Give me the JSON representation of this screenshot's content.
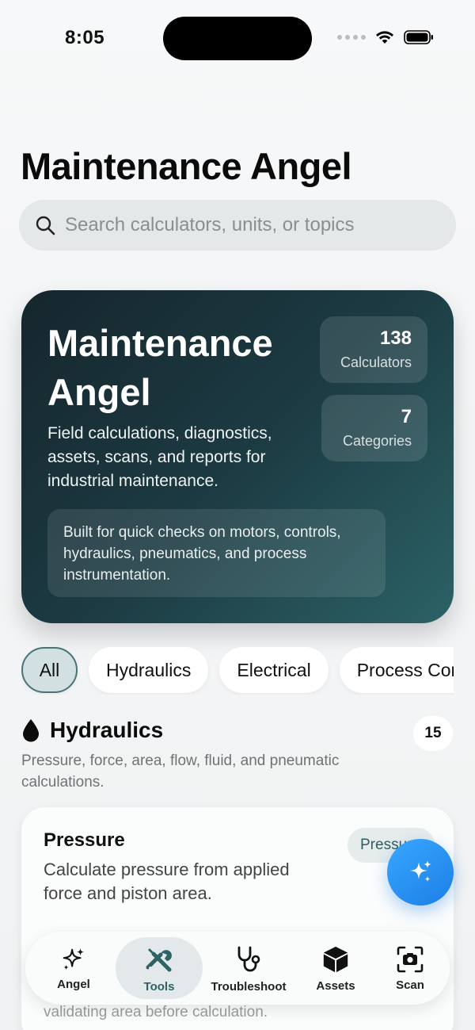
{
  "status": {
    "time": "8:05"
  },
  "app": {
    "title": "Maintenance Angel"
  },
  "search": {
    "placeholder": "Search calculators, units, or topics"
  },
  "hero": {
    "title": "Maintenance Angel",
    "subtitle": "Field calculations, diagnostics, assets, scans, and reports for industrial maintenance.",
    "stats": [
      {
        "value": "138",
        "label": "Calculators"
      },
      {
        "value": "7",
        "label": "Categories"
      }
    ],
    "note": "Built for quick checks on motors, controls, hydraulics, pneumatics, and process instrumentation."
  },
  "filters": {
    "chips": [
      {
        "label": "All",
        "active": true
      },
      {
        "label": "Hydraulics",
        "active": false
      },
      {
        "label": "Electrical",
        "active": false
      },
      {
        "label": "Process Control",
        "active": false
      }
    ]
  },
  "section": {
    "title": "Hydraulics",
    "count": "15",
    "description": "Pressure, force, area, flow, fluid, and pneumatic calculations.",
    "icon": "drop-icon"
  },
  "calculator": {
    "title": "Pressure",
    "description": "Calculate pressure from applied force and piston area.",
    "tag": "Pressure",
    "footer": "validating area before calculation."
  },
  "fab": {
    "icon": "sparkles-icon"
  },
  "tabbar": {
    "tabs": [
      {
        "label": "Angel",
        "icon": "sparkles-icon",
        "active": false
      },
      {
        "label": "Tools",
        "icon": "tools-icon",
        "active": true
      },
      {
        "label": "Troubleshoot",
        "icon": "stethoscope-icon",
        "active": false
      },
      {
        "label": "Assets",
        "icon": "box-icon",
        "active": false
      },
      {
        "label": "Scan",
        "icon": "camera-scan-icon",
        "active": false
      }
    ]
  },
  "colors": {
    "accent": "#2f6267",
    "fab": "#2a93f5",
    "hero_dark": "#16262d"
  }
}
